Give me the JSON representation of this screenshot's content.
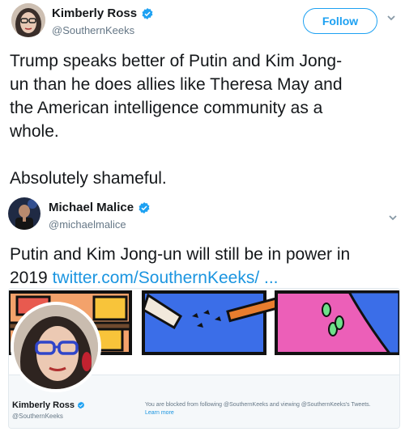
{
  "tweet1": {
    "name": "Kimberly Ross",
    "handle": "@SouthernKeeks",
    "follow_label": "Follow",
    "text_line1": "Trump speaks better of Putin and Kim Jong-",
    "text_line2": "un than he does allies like Theresa May and",
    "text_line3": "the American intelligence community as a",
    "text_line4": "whole.",
    "text_line5": "Absolutely shameful."
  },
  "tweet2": {
    "name": "Michael Malice",
    "handle": "@michaelmalice",
    "text_line1": "Putin and Kim Jong-un will still be in power in",
    "text_prefix": "2019 ",
    "link": "twitter.com/SouthernKeeks/ ..."
  },
  "card": {
    "name": "Kimberly Ross",
    "handle": "@SouthernKeeks",
    "blocked_text": "You are blocked from following @SouthernKeeks and viewing @SouthernKeeks's Tweets.",
    "learn_more": "Learn more"
  },
  "colors": {
    "accent": "#1da1f2",
    "link": "#1b95e0",
    "verified": "#1da1f2"
  }
}
